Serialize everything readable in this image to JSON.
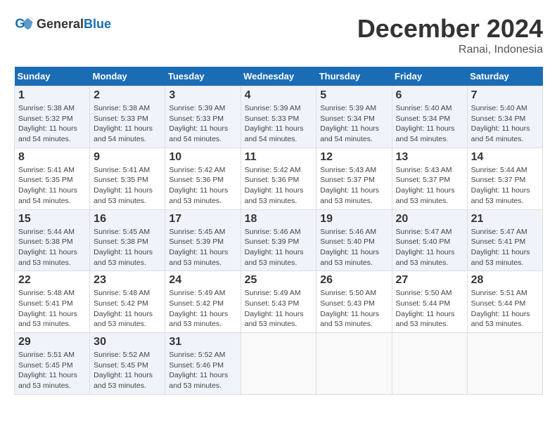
{
  "header": {
    "logo_general": "General",
    "logo_blue": "Blue",
    "month_title": "December 2024",
    "location": "Ranai, Indonesia"
  },
  "days_of_week": [
    "Sunday",
    "Monday",
    "Tuesday",
    "Wednesday",
    "Thursday",
    "Friday",
    "Saturday"
  ],
  "weeks": [
    {
      "days": [
        {
          "num": "1",
          "sunrise": "5:38 AM",
          "sunset": "5:32 PM",
          "daylight": "11 hours and 54 minutes."
        },
        {
          "num": "2",
          "sunrise": "5:38 AM",
          "sunset": "5:33 PM",
          "daylight": "11 hours and 54 minutes."
        },
        {
          "num": "3",
          "sunrise": "5:39 AM",
          "sunset": "5:33 PM",
          "daylight": "11 hours and 54 minutes."
        },
        {
          "num": "4",
          "sunrise": "5:39 AM",
          "sunset": "5:33 PM",
          "daylight": "11 hours and 54 minutes."
        },
        {
          "num": "5",
          "sunrise": "5:39 AM",
          "sunset": "5:34 PM",
          "daylight": "11 hours and 54 minutes."
        },
        {
          "num": "6",
          "sunrise": "5:40 AM",
          "sunset": "5:34 PM",
          "daylight": "11 hours and 54 minutes."
        },
        {
          "num": "7",
          "sunrise": "5:40 AM",
          "sunset": "5:34 PM",
          "daylight": "11 hours and 54 minutes."
        }
      ]
    },
    {
      "days": [
        {
          "num": "8",
          "sunrise": "5:41 AM",
          "sunset": "5:35 PM",
          "daylight": "11 hours and 54 minutes."
        },
        {
          "num": "9",
          "sunrise": "5:41 AM",
          "sunset": "5:35 PM",
          "daylight": "11 hours and 53 minutes."
        },
        {
          "num": "10",
          "sunrise": "5:42 AM",
          "sunset": "5:36 PM",
          "daylight": "11 hours and 53 minutes."
        },
        {
          "num": "11",
          "sunrise": "5:42 AM",
          "sunset": "5:36 PM",
          "daylight": "11 hours and 53 minutes."
        },
        {
          "num": "12",
          "sunrise": "5:43 AM",
          "sunset": "5:37 PM",
          "daylight": "11 hours and 53 minutes."
        },
        {
          "num": "13",
          "sunrise": "5:43 AM",
          "sunset": "5:37 PM",
          "daylight": "11 hours and 53 minutes."
        },
        {
          "num": "14",
          "sunrise": "5:44 AM",
          "sunset": "5:37 PM",
          "daylight": "11 hours and 53 minutes."
        }
      ]
    },
    {
      "days": [
        {
          "num": "15",
          "sunrise": "5:44 AM",
          "sunset": "5:38 PM",
          "daylight": "11 hours and 53 minutes."
        },
        {
          "num": "16",
          "sunrise": "5:45 AM",
          "sunset": "5:38 PM",
          "daylight": "11 hours and 53 minutes."
        },
        {
          "num": "17",
          "sunrise": "5:45 AM",
          "sunset": "5:39 PM",
          "daylight": "11 hours and 53 minutes."
        },
        {
          "num": "18",
          "sunrise": "5:46 AM",
          "sunset": "5:39 PM",
          "daylight": "11 hours and 53 minutes."
        },
        {
          "num": "19",
          "sunrise": "5:46 AM",
          "sunset": "5:40 PM",
          "daylight": "11 hours and 53 minutes."
        },
        {
          "num": "20",
          "sunrise": "5:47 AM",
          "sunset": "5:40 PM",
          "daylight": "11 hours and 53 minutes."
        },
        {
          "num": "21",
          "sunrise": "5:47 AM",
          "sunset": "5:41 PM",
          "daylight": "11 hours and 53 minutes."
        }
      ]
    },
    {
      "days": [
        {
          "num": "22",
          "sunrise": "5:48 AM",
          "sunset": "5:41 PM",
          "daylight": "11 hours and 53 minutes."
        },
        {
          "num": "23",
          "sunrise": "5:48 AM",
          "sunset": "5:42 PM",
          "daylight": "11 hours and 53 minutes."
        },
        {
          "num": "24",
          "sunrise": "5:49 AM",
          "sunset": "5:42 PM",
          "daylight": "11 hours and 53 minutes."
        },
        {
          "num": "25",
          "sunrise": "5:49 AM",
          "sunset": "5:43 PM",
          "daylight": "11 hours and 53 minutes."
        },
        {
          "num": "26",
          "sunrise": "5:50 AM",
          "sunset": "5:43 PM",
          "daylight": "11 hours and 53 minutes."
        },
        {
          "num": "27",
          "sunrise": "5:50 AM",
          "sunset": "5:44 PM",
          "daylight": "11 hours and 53 minutes."
        },
        {
          "num": "28",
          "sunrise": "5:51 AM",
          "sunset": "5:44 PM",
          "daylight": "11 hours and 53 minutes."
        }
      ]
    },
    {
      "days": [
        {
          "num": "29",
          "sunrise": "5:51 AM",
          "sunset": "5:45 PM",
          "daylight": "11 hours and 53 minutes."
        },
        {
          "num": "30",
          "sunrise": "5:52 AM",
          "sunset": "5:45 PM",
          "daylight": "11 hours and 53 minutes."
        },
        {
          "num": "31",
          "sunrise": "5:52 AM",
          "sunset": "5:46 PM",
          "daylight": "11 hours and 53 minutes."
        },
        null,
        null,
        null,
        null
      ]
    }
  ]
}
